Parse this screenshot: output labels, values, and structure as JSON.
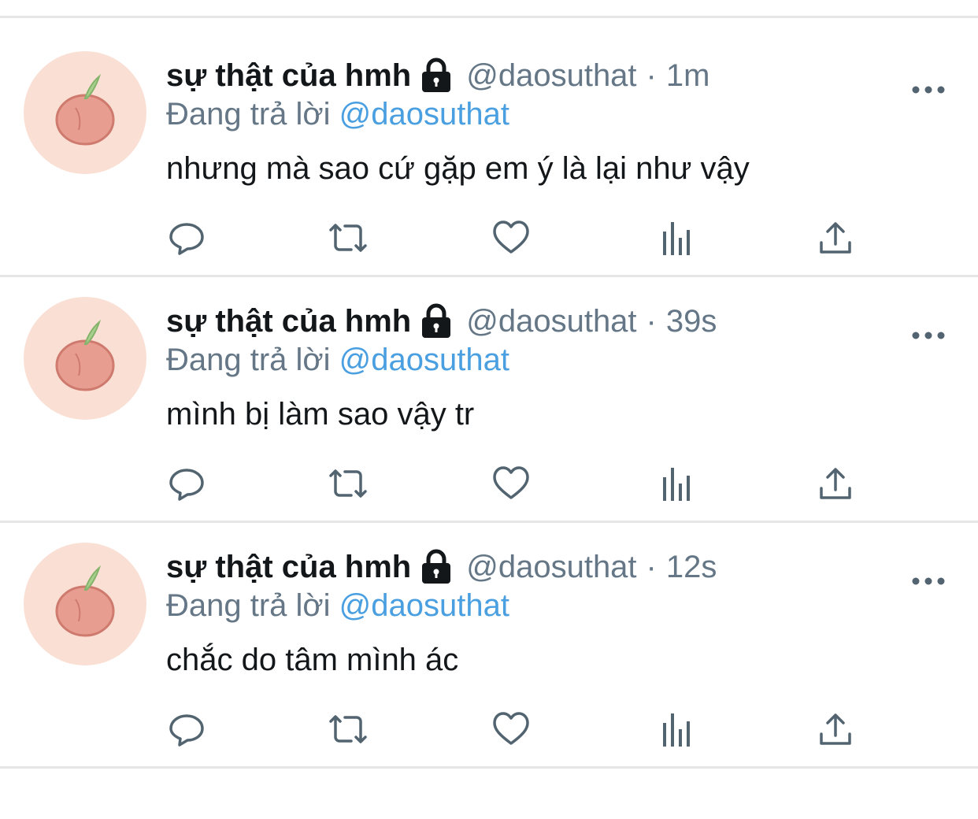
{
  "tweets": [
    {
      "display_name": "sự thật của hmh",
      "handle": "@daosuthat",
      "separator": "·",
      "time": "1m",
      "reply_prefix": "Đang trả lời",
      "reply_to": "@daosuthat",
      "text": "nhưng mà sao cứ gặp em ý là lại như vậy"
    },
    {
      "display_name": "sự thật của hmh",
      "handle": "@daosuthat",
      "separator": "·",
      "time": "39s",
      "reply_prefix": "Đang trả lời",
      "reply_to": "@daosuthat",
      "text": "mình bị làm sao vậy tr"
    },
    {
      "display_name": "sự thật của hmh",
      "handle": "@daosuthat",
      "separator": "·",
      "time": "12s",
      "reply_prefix": "Đang trả lời",
      "reply_to": "@daosuthat",
      "text": "chắc do tâm mình ác"
    }
  ],
  "icons": {
    "avatar": "peach-avatar",
    "protected": "lock-icon",
    "more": "more-options-icon",
    "actions": [
      "reply-icon",
      "retweet-icon",
      "like-icon",
      "analytics-icon",
      "share-icon"
    ]
  },
  "colors": {
    "text": "#14171a",
    "secondary": "#657786",
    "link": "#4a9fe0",
    "avatar_bg": "#fae0d4",
    "divider": "#e6e6e6"
  }
}
